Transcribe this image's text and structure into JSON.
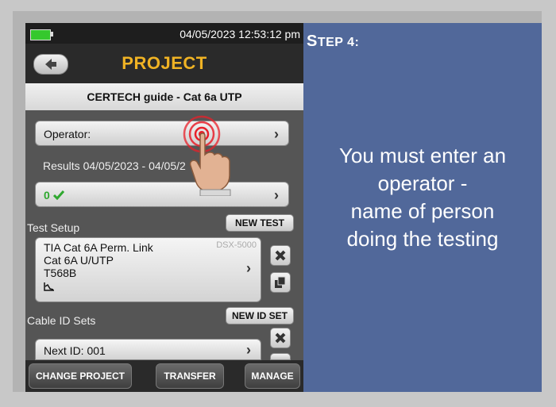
{
  "status": {
    "datetime": "04/05/2023 12:53:12 pm"
  },
  "header": {
    "title": "PROJECT",
    "project_name": "CERTECH guide - Cat 6a UTP"
  },
  "operator": {
    "label": "Operator:"
  },
  "results": {
    "label": "Results 04/05/2023 - 04/05/2",
    "count": "0"
  },
  "test_setup": {
    "label": "Test Setup",
    "new_test": "NEW TEST",
    "line1": "TIA Cat 6A Perm. Link",
    "line2": "Cat 6A U/UTP",
    "line3": "T568B",
    "model": "DSX-5000"
  },
  "cable_id": {
    "label": "Cable ID Sets",
    "new_id_set": "NEW ID SET",
    "next_id": "Next ID: 001"
  },
  "bottom_bar": {
    "change_project": "CHANGE PROJECT",
    "transfer": "TRANSFER",
    "manage": "MANAGE"
  },
  "instruction_panel": {
    "step_first": "S",
    "step_rest": "TEP 4:",
    "line1": "You must enter an",
    "line2": "operator -",
    "line3": "name of person",
    "line4": "doing the testing"
  },
  "colors": {
    "accent_title": "#f0b324",
    "battery": "#35c82d",
    "pass_check": "#2fa82f",
    "panel_bg": "#51689a",
    "tap_indicator": "#e8202a"
  },
  "icons": [
    "battery-icon",
    "back-arrow-icon",
    "chevron-right-icon",
    "check-icon",
    "close-icon",
    "copy-icon",
    "graph-icon",
    "tap-target-icon",
    "pointing-hand-icon"
  ]
}
